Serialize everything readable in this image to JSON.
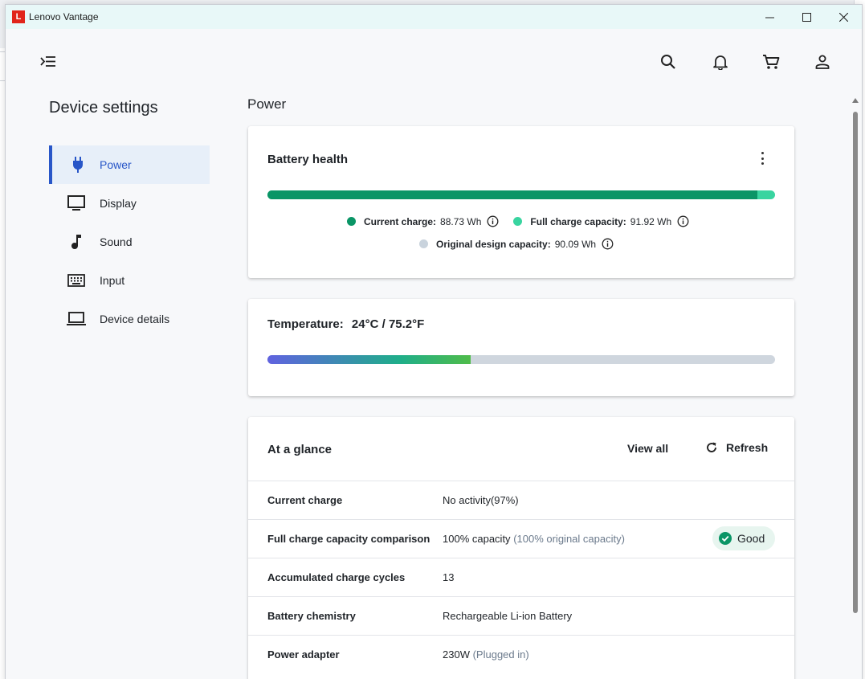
{
  "window": {
    "app_logo": "L",
    "app_title": "Lenovo Vantage"
  },
  "topbar": {
    "menu_icon": "menu-collapse-icon",
    "search_icon": "search-icon",
    "bell_icon": "bell-icon",
    "cart_icon": "cart-icon",
    "account_icon": "account-icon"
  },
  "sidebar": {
    "title": "Device settings",
    "items": [
      {
        "label": "Power",
        "icon": "plug-icon",
        "active": true
      },
      {
        "label": "Display",
        "icon": "monitor-icon"
      },
      {
        "label": "Sound",
        "icon": "music-note-icon"
      },
      {
        "label": "Input",
        "icon": "keyboard-icon"
      },
      {
        "label": "Device details",
        "icon": "laptop-icon"
      }
    ]
  },
  "main": {
    "section_title": "Power",
    "battery_health": {
      "title": "Battery health",
      "bar_fraction_current": 0.965,
      "current_charge_label": "Current charge:",
      "current_charge_value": "88.73 Wh",
      "full_capacity_label": "Full charge capacity:",
      "full_capacity_value": "91.92 Wh",
      "design_capacity_label": "Original design capacity:",
      "design_capacity_value": "90.09 Wh",
      "colors": {
        "current": "#0a9566",
        "full": "#39d4a0",
        "design": "#c9d3dd"
      }
    },
    "temperature": {
      "label": "Temperature:",
      "value": "24°C / 75.2°F",
      "bar_fraction": 0.4
    },
    "at_a_glance": {
      "title": "At a glance",
      "view_all": "View all",
      "refresh": "Refresh",
      "rows": [
        {
          "label": "Current charge",
          "value": "No activity(97%)",
          "muted": ""
        },
        {
          "label": "Full charge capacity comparison",
          "value": "100% capacity",
          "muted": "(100% original capacity)",
          "badge": "Good"
        },
        {
          "label": "Accumulated charge cycles",
          "value": "13",
          "muted": ""
        },
        {
          "label": "Battery chemistry",
          "value": "Rechargeable Li-ion Battery",
          "muted": ""
        },
        {
          "label": "Power adapter",
          "value": "230W",
          "muted": "(Plugged in)"
        }
      ]
    }
  }
}
